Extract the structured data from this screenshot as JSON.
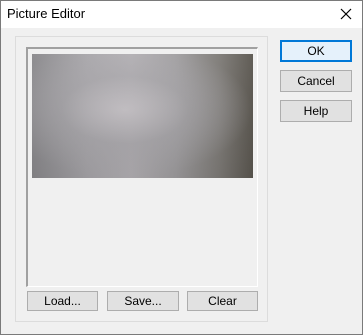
{
  "window": {
    "title": "Picture Editor"
  },
  "icons": {
    "close": "close-icon"
  },
  "picture_buttons": {
    "load": "Load...",
    "save": "Save...",
    "clear": "Clear"
  },
  "dialog_buttons": {
    "ok": "OK",
    "cancel": "Cancel",
    "help": "Help"
  },
  "colors": {
    "default_button_border": "#0078d7",
    "window_background": "#f0f0f0"
  }
}
